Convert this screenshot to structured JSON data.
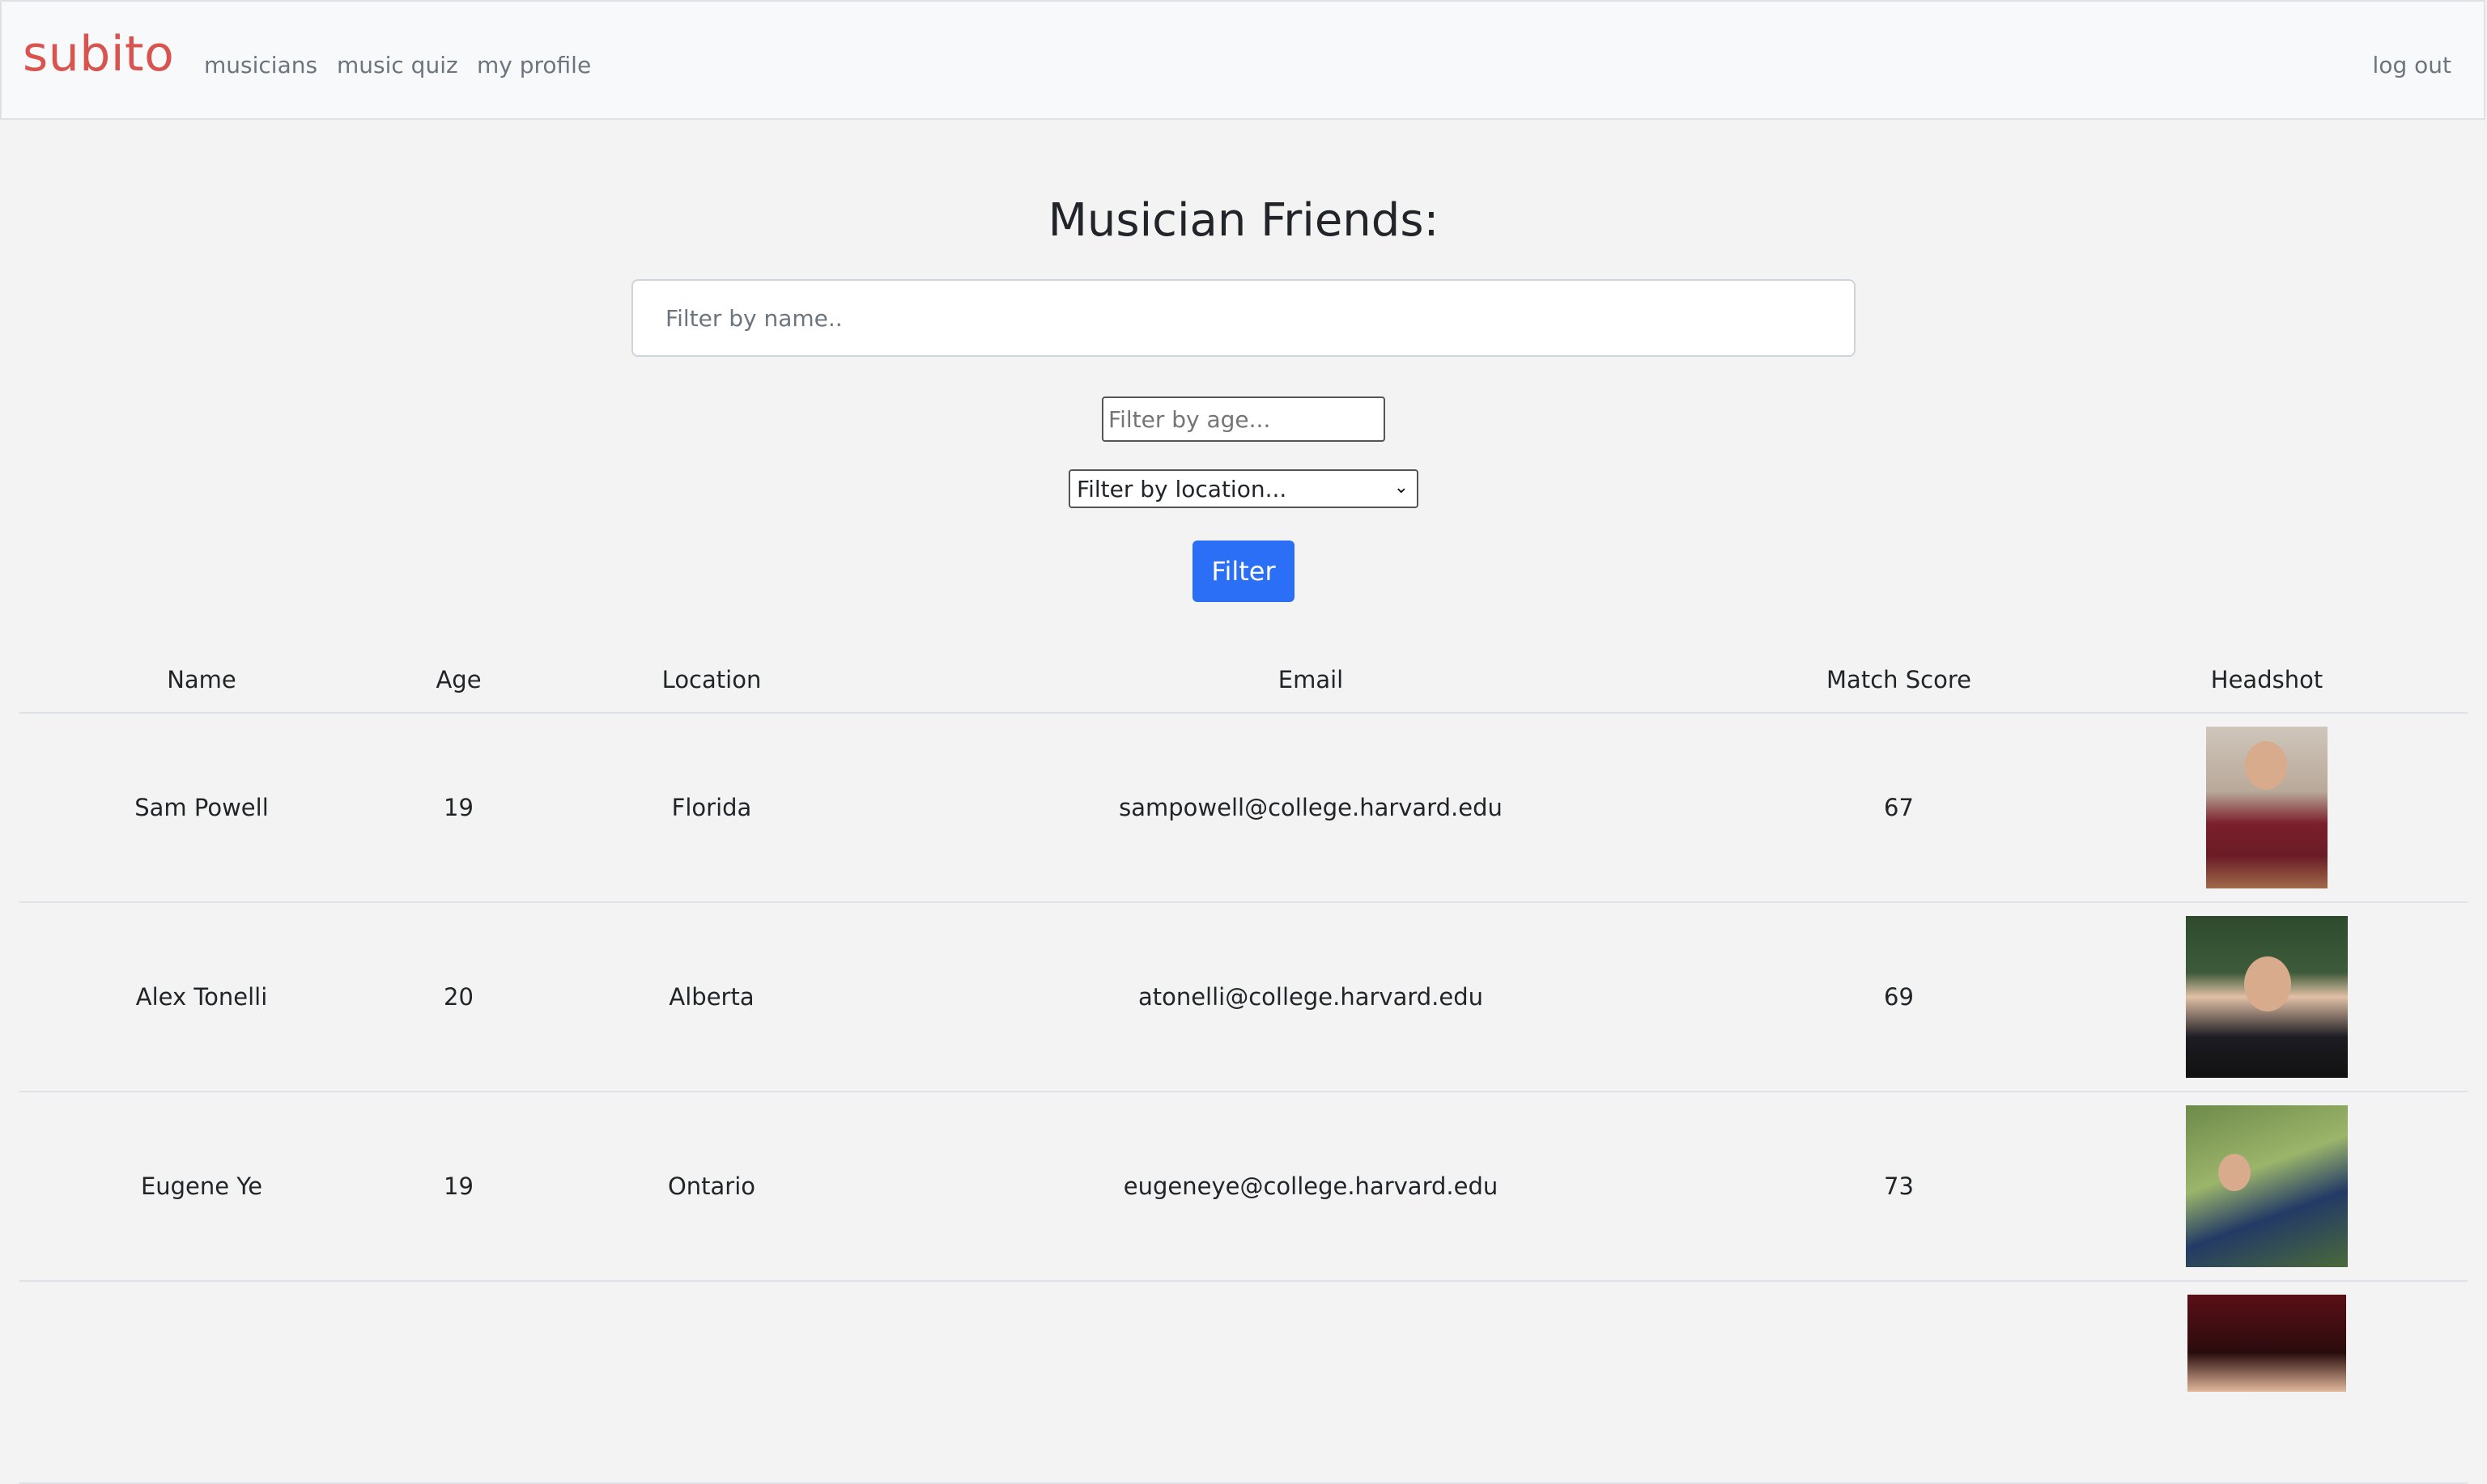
{
  "nav": {
    "brand": "subito",
    "links": [
      "musicians",
      "music quiz",
      "my profile"
    ],
    "logout": "log out"
  },
  "page": {
    "title": "Musician Friends:"
  },
  "filters": {
    "name_placeholder": "Filter by name..",
    "age_placeholder": "Filter by age...",
    "location_selected": "Filter by location...",
    "button_label": "Filter"
  },
  "table": {
    "headers": [
      "Name",
      "Age",
      "Location",
      "Email",
      "Match Score",
      "Headshot"
    ],
    "rows": [
      {
        "name": "Sam Powell",
        "age": "19",
        "location": "Florida",
        "email": "sampowell@college.harvard.edu",
        "score": "67"
      },
      {
        "name": "Alex Tonelli",
        "age": "20",
        "location": "Alberta",
        "email": "atonelli@college.harvard.edu",
        "score": "69"
      },
      {
        "name": "Eugene Ye",
        "age": "19",
        "location": "Ontario",
        "email": "eugeneye@college.harvard.edu",
        "score": "73"
      }
    ]
  }
}
